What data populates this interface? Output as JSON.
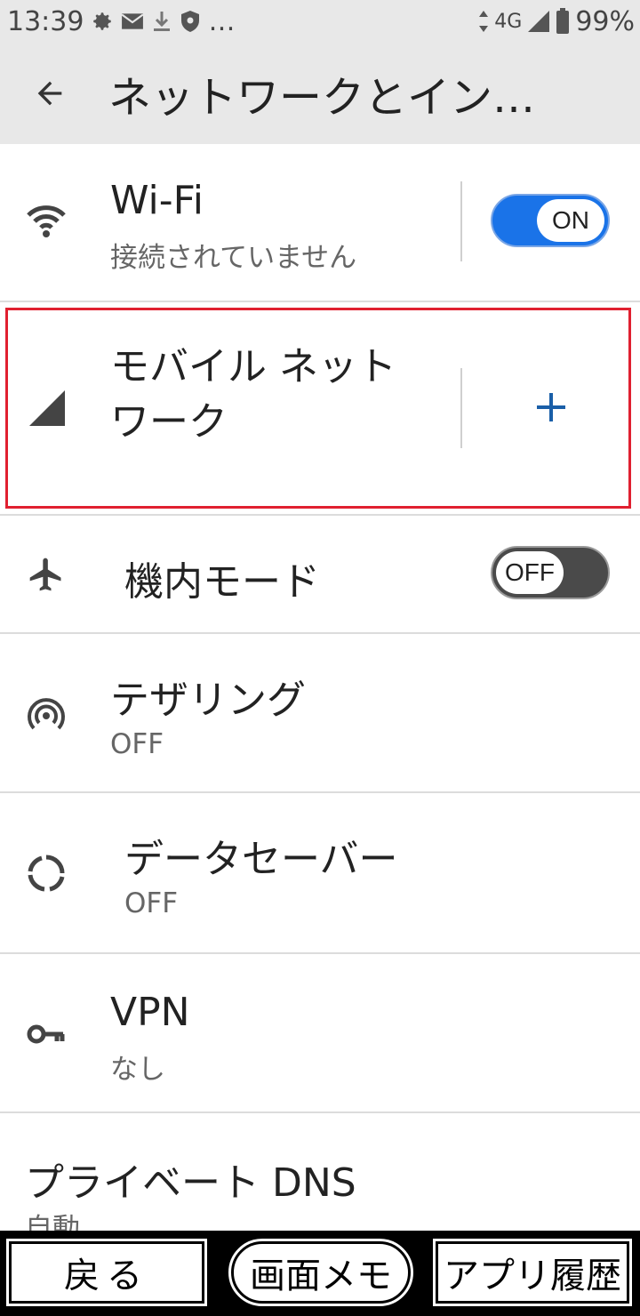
{
  "status_bar": {
    "time": "13:39",
    "network": "4G",
    "battery": "99%",
    "more": "…"
  },
  "app_bar": {
    "title": "ネットワークとイン…"
  },
  "rows": {
    "wifi": {
      "title": "Wi-Fi",
      "subtitle": "接続されていません",
      "toggle": "ON"
    },
    "mobile": {
      "title_line1": "モバイル ネット",
      "title_line2": "ワーク"
    },
    "airplane": {
      "title": "機内モード",
      "toggle": "OFF"
    },
    "tethering": {
      "title": "テザリング",
      "subtitle": "OFF"
    },
    "datasaver": {
      "title": "データセーバー",
      "subtitle": "OFF"
    },
    "vpn": {
      "title": "VPN",
      "subtitle": "なし"
    },
    "dns": {
      "title": "プライベート DNS",
      "subtitle": "自動"
    }
  },
  "bottom_bar": {
    "back": "戻る",
    "memo": "画面メモ",
    "history": "アプリ履歴"
  },
  "colors": {
    "accent": "#1a73e8",
    "highlight": "#e02030",
    "plus": "#1a5fa8"
  }
}
